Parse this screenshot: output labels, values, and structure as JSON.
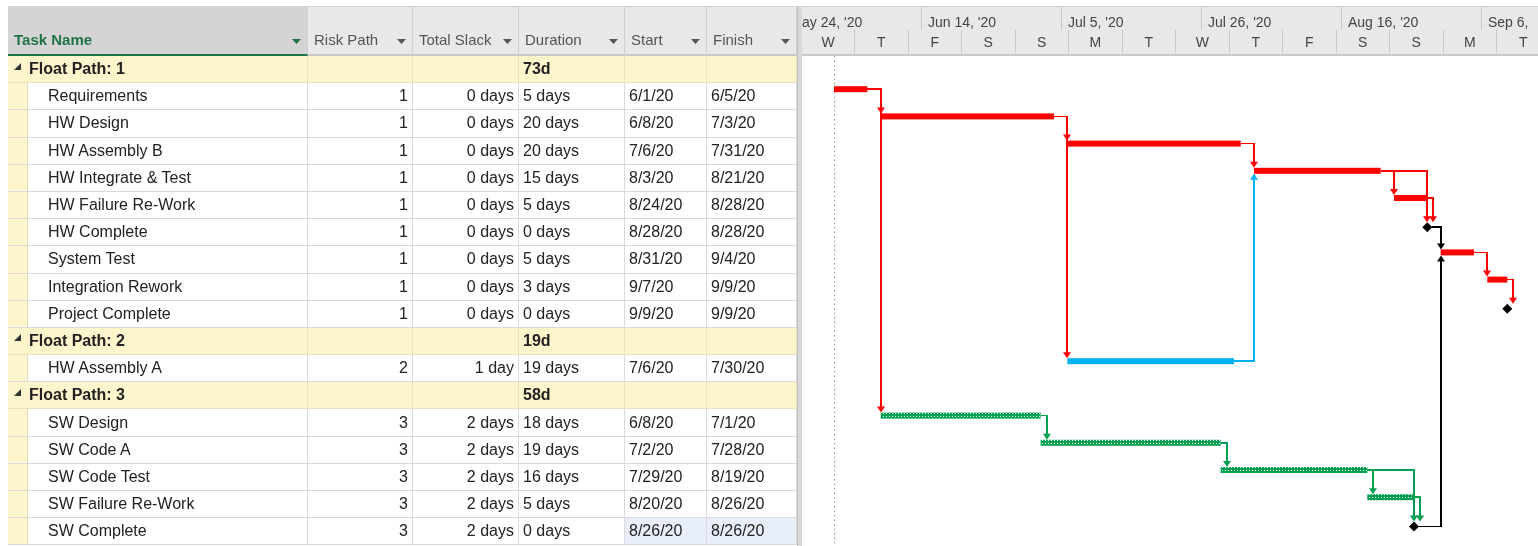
{
  "columns": [
    {
      "label": "Task Name",
      "highlighted": true
    },
    {
      "label": "Risk Path",
      "highlighted": false
    },
    {
      "label": "Total Slack",
      "highlighted": false
    },
    {
      "label": "Duration",
      "highlighted": false
    },
    {
      "label": "Start",
      "highlighted": false
    },
    {
      "label": "Finish",
      "highlighted": false
    }
  ],
  "timescale": {
    "major": [
      "ay 24, '20",
      "Jun 14, '20",
      "Jul 5, '20",
      "Jul 26, '20",
      "Aug 16, '20",
      "Sep 6,"
    ],
    "minor": [
      "W",
      "T",
      "F",
      "S",
      "S",
      "M",
      "T",
      "W",
      "T",
      "F",
      "S",
      "S",
      "M",
      "T"
    ]
  },
  "rows": [
    {
      "kind": "summary",
      "name": "Float Path: 1",
      "expanded": true,
      "duration": "73d",
      "selected": false
    },
    {
      "kind": "task",
      "name": "Requirements",
      "risk_path": "1",
      "total_slack": "0 days",
      "duration": "5 days",
      "start": "6/1/20",
      "finish": "6/5/20",
      "color": "#ff0000",
      "hatched": false,
      "selected": false
    },
    {
      "kind": "task",
      "name": "HW Design",
      "risk_path": "1",
      "total_slack": "0 days",
      "duration": "20 days",
      "start": "6/8/20",
      "finish": "7/3/20",
      "color": "#ff0000",
      "hatched": false,
      "selected": false
    },
    {
      "kind": "task",
      "name": "HW Assembly B",
      "risk_path": "1",
      "total_slack": "0 days",
      "duration": "20 days",
      "start": "7/6/20",
      "finish": "7/31/20",
      "color": "#ff0000",
      "hatched": false,
      "selected": false
    },
    {
      "kind": "task",
      "name": "HW Integrate & Test",
      "risk_path": "1",
      "total_slack": "0 days",
      "duration": "15 days",
      "start": "8/3/20",
      "finish": "8/21/20",
      "color": "#ff0000",
      "hatched": false,
      "selected": false
    },
    {
      "kind": "task",
      "name": "HW Failure Re-Work",
      "risk_path": "1",
      "total_slack": "0 days",
      "duration": "5 days",
      "start": "8/24/20",
      "finish": "8/28/20",
      "color": "#ff0000",
      "hatched": false,
      "selected": false
    },
    {
      "kind": "milestone",
      "name": "HW Complete",
      "risk_path": "1",
      "total_slack": "0 days",
      "duration": "0 days",
      "start": "8/28/20",
      "finish": "8/28/20",
      "selected": false
    },
    {
      "kind": "task",
      "name": "System Test",
      "risk_path": "1",
      "total_slack": "0 days",
      "duration": "5 days",
      "start": "8/31/20",
      "finish": "9/4/20",
      "color": "#ff0000",
      "hatched": false,
      "selected": false
    },
    {
      "kind": "task",
      "name": "Integration Rework",
      "risk_path": "1",
      "total_slack": "0 days",
      "duration": "3 days",
      "start": "9/7/20",
      "finish": "9/9/20",
      "color": "#ff0000",
      "hatched": false,
      "selected": false
    },
    {
      "kind": "milestone",
      "name": "Project Complete",
      "risk_path": "1",
      "total_slack": "0 days",
      "duration": "0 days",
      "start": "9/9/20",
      "finish": "9/9/20",
      "selected": false
    },
    {
      "kind": "summary",
      "name": "Float Path: 2",
      "expanded": true,
      "duration": "19d",
      "selected": false
    },
    {
      "kind": "task",
      "name": "HW Assembly A",
      "risk_path": "2",
      "total_slack": "1 day",
      "duration": "19 days",
      "start": "7/6/20",
      "finish": "7/30/20",
      "color": "#00b0f0",
      "hatched": false,
      "selected": false
    },
    {
      "kind": "summary",
      "name": "Float Path: 3",
      "expanded": true,
      "duration": "58d",
      "selected": false
    },
    {
      "kind": "task",
      "name": "SW Design",
      "risk_path": "3",
      "total_slack": "2 days",
      "duration": "18 days",
      "start": "6/8/20",
      "finish": "7/1/20",
      "color": "#00a050",
      "hatched": true,
      "selected": false
    },
    {
      "kind": "task",
      "name": "SW Code A",
      "risk_path": "3",
      "total_slack": "2 days",
      "duration": "19 days",
      "start": "7/2/20",
      "finish": "7/28/20",
      "color": "#00a050",
      "hatched": true,
      "selected": false
    },
    {
      "kind": "task",
      "name": "SW Code Test",
      "risk_path": "3",
      "total_slack": "2 days",
      "duration": "16 days",
      "start": "7/29/20",
      "finish": "8/19/20",
      "color": "#00a050",
      "hatched": true,
      "selected": false
    },
    {
      "kind": "task",
      "name": "SW Failure Re-Work",
      "risk_path": "3",
      "total_slack": "2 days",
      "duration": "5 days",
      "start": "8/20/20",
      "finish": "8/26/20",
      "color": "#00a050",
      "hatched": true,
      "selected": false
    },
    {
      "kind": "milestone",
      "name": "SW Complete",
      "risk_path": "3",
      "total_slack": "2 days",
      "duration": "0 days",
      "start": "8/26/20",
      "finish": "8/26/20",
      "selected": true
    }
  ]
}
